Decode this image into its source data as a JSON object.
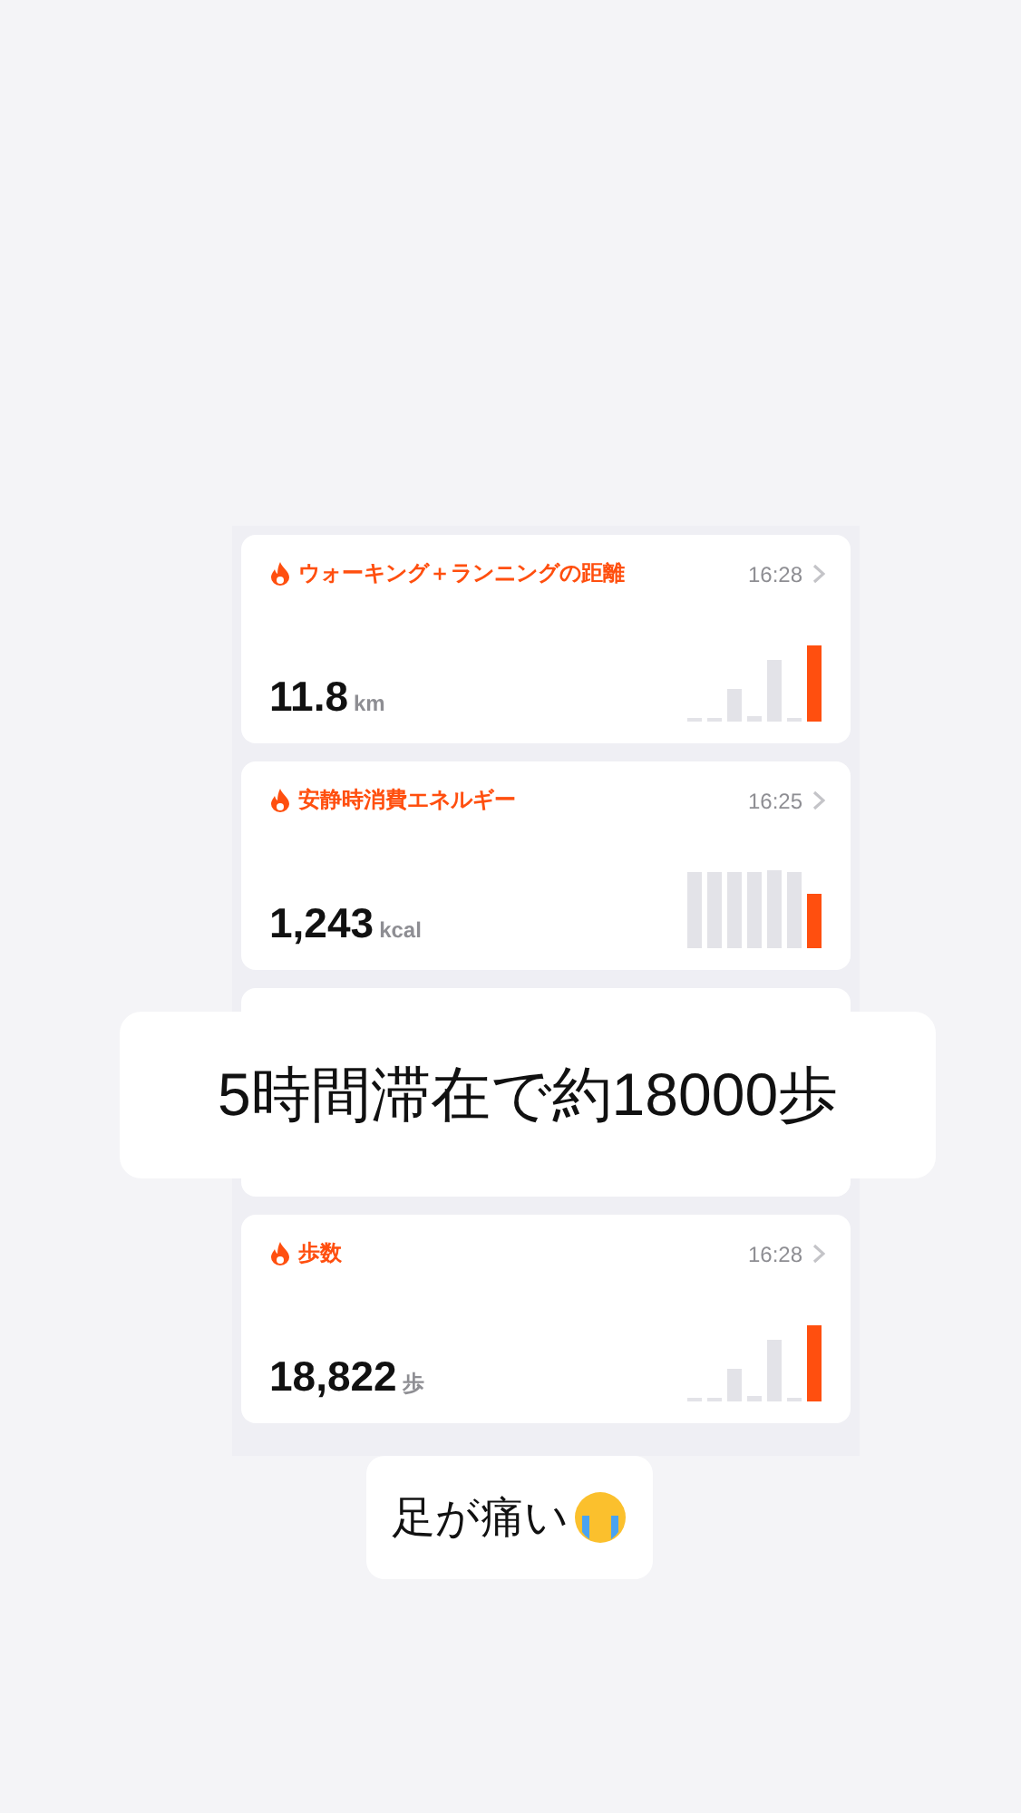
{
  "cards": [
    {
      "kind": "spike",
      "title": "ウォーキング＋ランニングの距離",
      "time": "16:28",
      "value": "11.8",
      "unit": "km"
    },
    {
      "kind": "steady",
      "title": "安静時消費エネルギー",
      "time": "16:25",
      "value": "1,243",
      "unit": "kcal"
    },
    {
      "kind": "blank"
    },
    {
      "kind": "spike",
      "title": "歩数",
      "time": "16:28",
      "value": "18,822",
      "unit": "歩"
    }
  ],
  "captions": [
    {
      "kind": "overlay",
      "text": "5時間滞在で約18000歩"
    },
    {
      "kind": "below",
      "text": "足が痛い"
    }
  ]
}
